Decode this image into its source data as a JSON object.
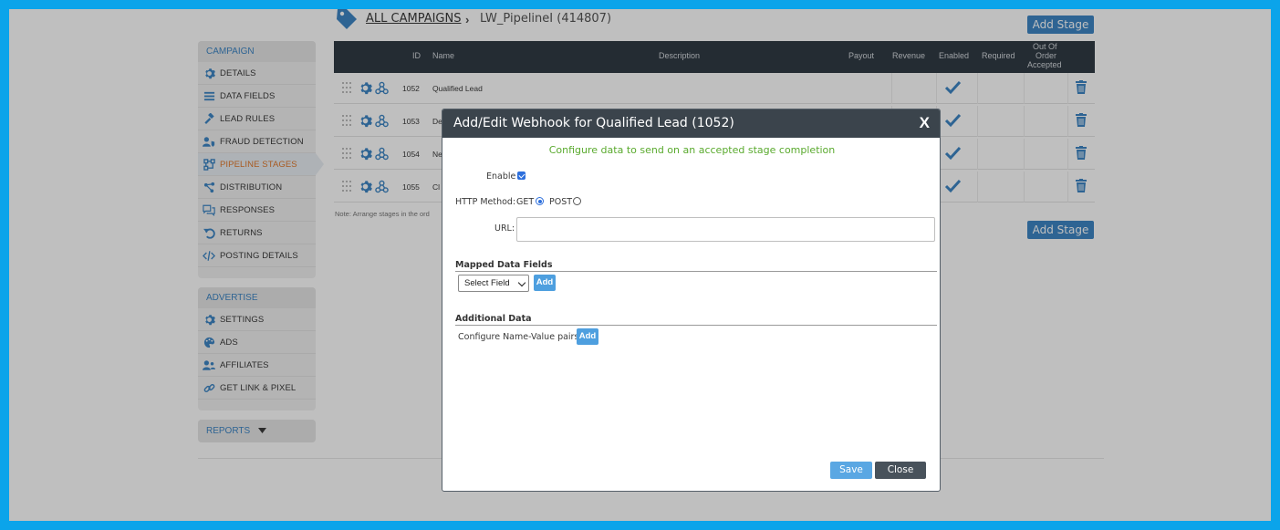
{
  "breadcrumb": {
    "all_campaigns": "ALL CAMPAIGNS",
    "separator": "›",
    "current": "LW_PipelineI (414807)"
  },
  "toolbar": {
    "add_stage_label": "Add Stage"
  },
  "sidebar": {
    "campaign_header": "CAMPAIGN",
    "campaign_items": [
      {
        "label": "DETAILS",
        "icon": "gear-icon"
      },
      {
        "label": "DATA FIELDS",
        "icon": "list-icon"
      },
      {
        "label": "LEAD RULES",
        "icon": "gavel-icon"
      },
      {
        "label": "FRAUD DETECTION",
        "icon": "user-shield-icon"
      },
      {
        "label": "PIPELINE STAGES",
        "icon": "pipeline-icon"
      },
      {
        "label": "DISTRIBUTION",
        "icon": "share-icon"
      },
      {
        "label": "RESPONSES",
        "icon": "comments-icon"
      },
      {
        "label": "RETURNS",
        "icon": "undo-icon"
      },
      {
        "label": "POSTING DETAILS",
        "icon": "code-icon"
      }
    ],
    "advertise_header": "ADVERTISE",
    "advertise_items": [
      {
        "label": "SETTINGS",
        "icon": "gear-icon"
      },
      {
        "label": "ADS",
        "icon": "palette-icon"
      },
      {
        "label": "AFFILIATES",
        "icon": "users-icon"
      },
      {
        "label": "GET LINK & PIXEL",
        "icon": "link-icon"
      }
    ],
    "reports_header": "REPORTS",
    "active_item": "PIPELINE STAGES",
    "accent_color": "#3e86c5",
    "active_color": "#e07a2f"
  },
  "table": {
    "headers": {
      "id": "ID",
      "name": "Name",
      "description": "Description",
      "payout": "Payout",
      "revenue": "Revenue",
      "enabled": "Enabled",
      "required": "Required",
      "out_of_order_l1": "Out Of",
      "out_of_order_l2": "Order",
      "out_of_order_l3": "Accepted"
    },
    "rows": [
      {
        "id": "1052",
        "name": "Qualified Lead"
      },
      {
        "id": "1053",
        "name": "De"
      },
      {
        "id": "1054",
        "name": "Ne"
      },
      {
        "id": "1055",
        "name": "Cl"
      }
    ],
    "note": "Note: Arrange stages in the ord"
  },
  "modal": {
    "title": "Add/Edit Webhook for Qualified Lead (1052)",
    "close_glyph": "X",
    "subtitle": "Configure data to send on an accepted stage completion",
    "enable_label": "Enable",
    "enable_checked": true,
    "http_method_label": "HTTP Method:",
    "get_label": "GET",
    "post_label": "POST",
    "method_selected": "GET",
    "url_label": "URL:",
    "url_value": "",
    "mapped_title": "Mapped Data Fields",
    "select_field_value": "Select Field",
    "add_label": "Add",
    "additional_title": "Additional Data",
    "name_value_label": "Configure Name-Value pairs",
    "save_label": "Save",
    "close_label": "Close"
  }
}
